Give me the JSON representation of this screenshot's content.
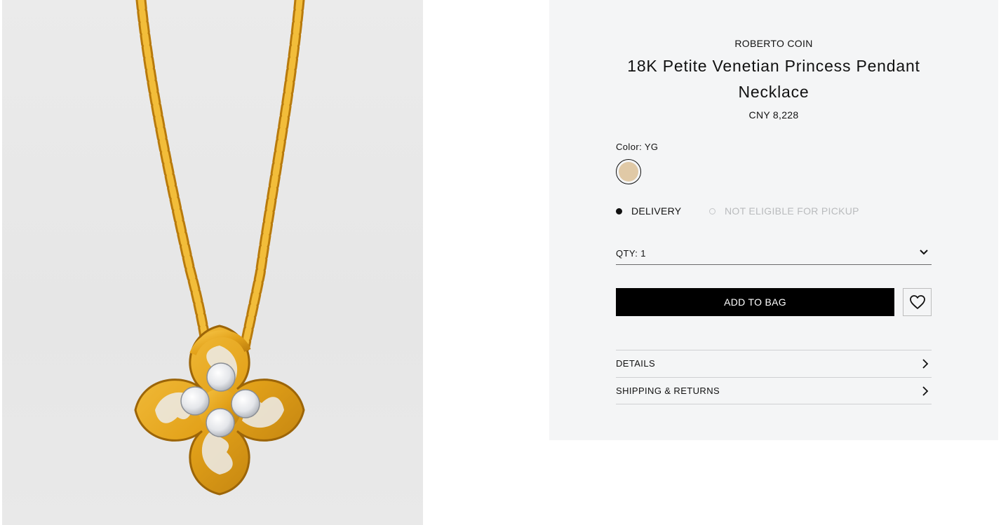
{
  "product": {
    "brand": "ROBERTO COIN",
    "title": "18K Petite Venetian Princess Pendant Necklace",
    "price": "CNY 8,228",
    "image_alt": "18K Petite Venetian Princess Pendant Necklace"
  },
  "color": {
    "label": "Color: YG",
    "swatch_color": "#e0c9a6"
  },
  "fulfillment": {
    "delivery_label": "DELIVERY",
    "pickup_label": "NOT ELIGIBLE FOR PICKUP"
  },
  "quantity": {
    "label": "QTY: 1"
  },
  "actions": {
    "add_to_bag": "ADD TO BAG",
    "wishlist_icon": "heart-icon"
  },
  "accordion": {
    "details": "DETAILS",
    "shipping": "SHIPPING & RETURNS"
  },
  "colors": {
    "gold": "#e3a21a",
    "gold_dark": "#b87a0c",
    "button_bg": "#000000",
    "panel_bg": "#f4f5f6"
  }
}
